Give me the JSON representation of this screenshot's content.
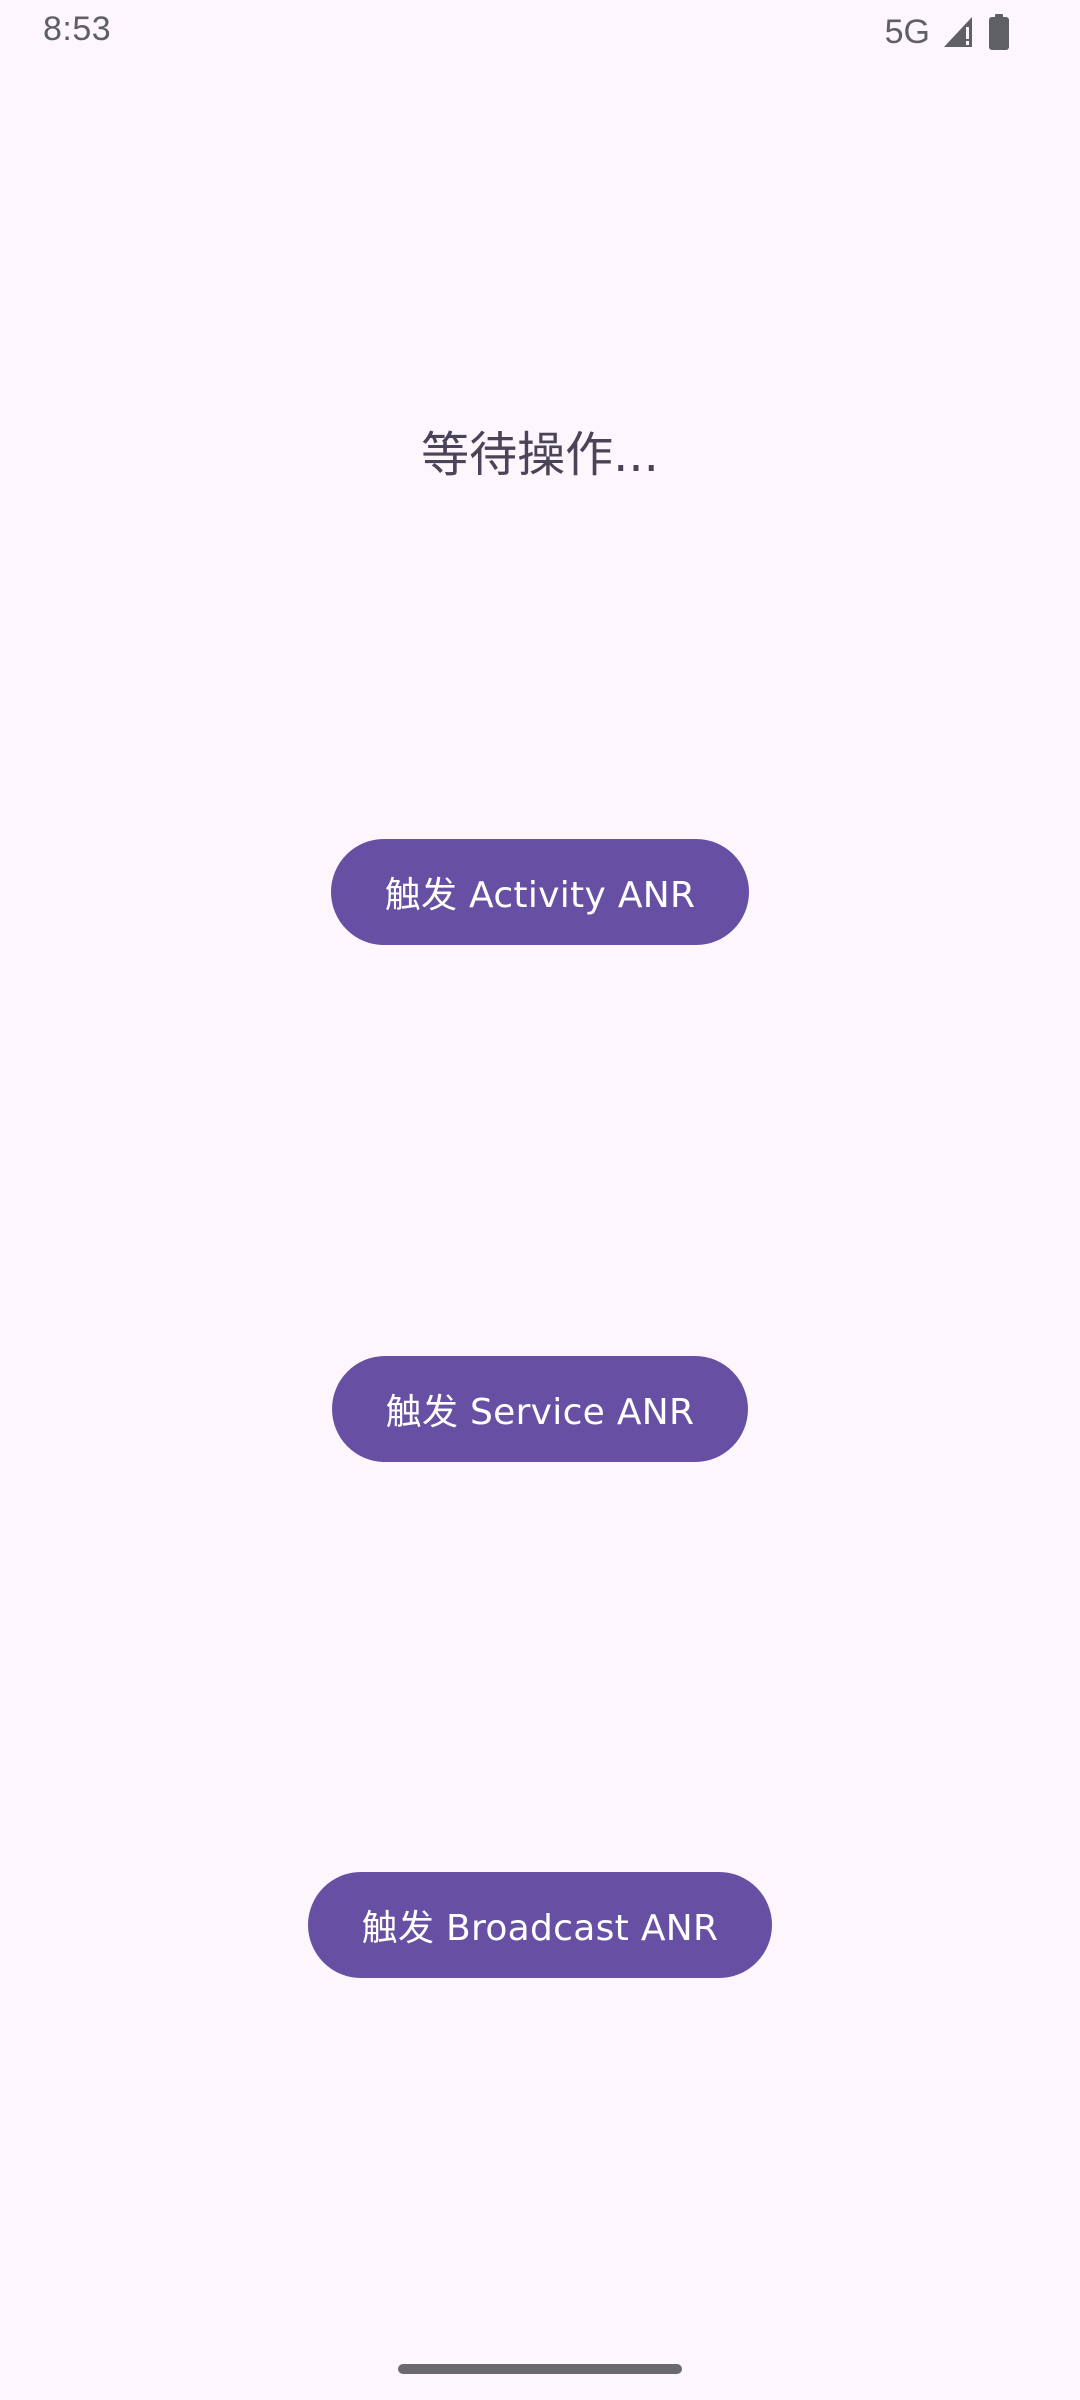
{
  "status_bar": {
    "time": "8:53",
    "network": "5G",
    "signal_icon": "signal-icon",
    "battery_icon": "battery-icon"
  },
  "main": {
    "status_message": "等待操作...",
    "buttons": [
      {
        "label": "触发 Activity ANR"
      },
      {
        "label": "触发 Service ANR"
      },
      {
        "label": "触发 Broadcast ANR"
      }
    ]
  },
  "colors": {
    "background": "#fdf7fd",
    "button": "#6750a4",
    "button_text": "#ffffff",
    "message_text": "#4a4458"
  }
}
